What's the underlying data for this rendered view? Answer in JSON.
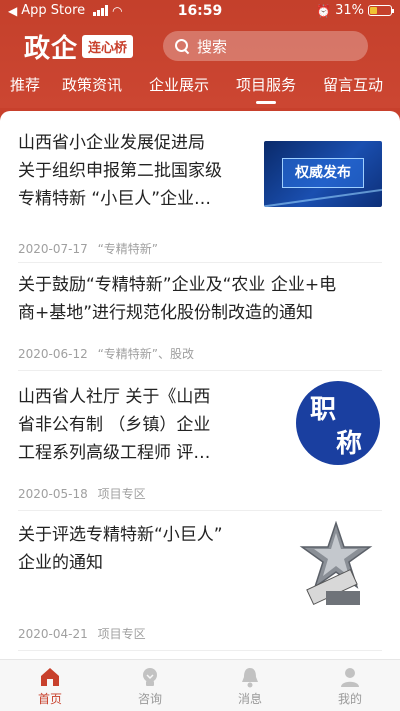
{
  "status_bar": {
    "carrier": "App Store",
    "time": "16:59",
    "battery": "31%"
  },
  "header": {
    "logo_main": "政企",
    "logo_tag": "连心桥",
    "search_placeholder": "搜索"
  },
  "tabs": [
    {
      "label": "推荐"
    },
    {
      "label": "政策资讯"
    },
    {
      "label": "企业展示"
    },
    {
      "label": "项目服务",
      "active": true
    },
    {
      "label": "留言互动"
    }
  ],
  "articles": [
    {
      "title_lines": [
        "山西省小企业发展促进局",
        "关于组织申报第二批国家级",
        "专精特新 “小巨人”企业…"
      ],
      "date": "2020-07-17",
      "tag": "“专精特新”",
      "thumb_text": "权威发布"
    },
    {
      "title_lines": [
        "关于鼓励“专精特新”企业及“农业 企业+电",
        "商+基地”进行规范化股份制改造的通知"
      ],
      "date": "2020-06-12",
      "tag": "“专精特新”、股改"
    },
    {
      "title_lines": [
        "山西省人社厅 关于《山西",
        "省非公有制 （乡镇）企业",
        "工程系列高级工程师 评…"
      ],
      "date": "2020-05-18",
      "tag": "项目专区",
      "thumb_chars": [
        "职",
        "称"
      ]
    },
    {
      "title_lines": [
        "关于评选专精特新“小巨人”",
        "企业的通知"
      ],
      "date": "2020-04-21",
      "tag": "项目专区"
    }
  ],
  "bottom_nav": [
    {
      "label": "首页",
      "icon": "home-icon",
      "active": true
    },
    {
      "label": "咨询",
      "icon": "lightbulb-icon"
    },
    {
      "label": "消息",
      "icon": "bell-icon"
    },
    {
      "label": "我的",
      "icon": "user-icon"
    }
  ],
  "colors": {
    "brand_red": "#c8402c",
    "meta_gray": "#a0a0a0"
  }
}
